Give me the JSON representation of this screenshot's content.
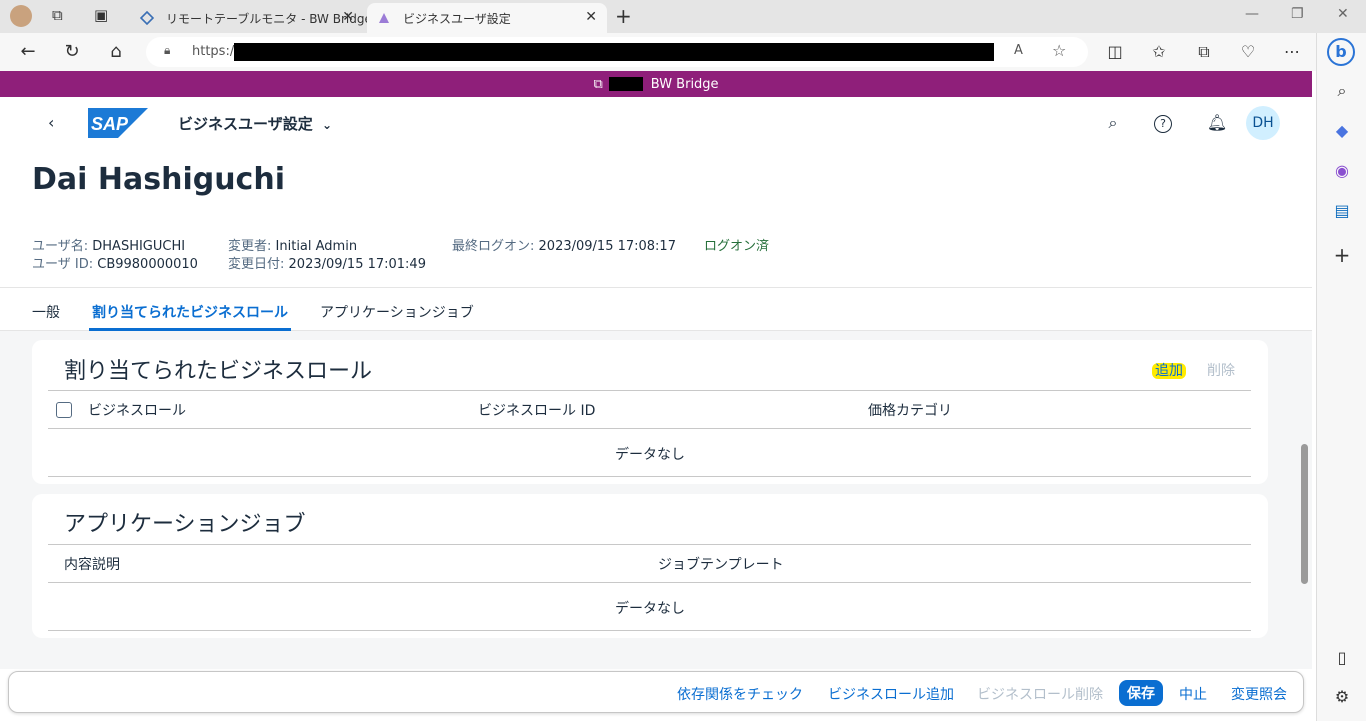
{
  "browser": {
    "tabs": [
      {
        "label": "リモートテーブルモニタ - BW Bridge (S",
        "active": false
      },
      {
        "label": "ビジネスユーザ設定",
        "active": true
      }
    ],
    "url_prefix": "https:/"
  },
  "banner": {
    "label": "BW Bridge"
  },
  "shell": {
    "app_title": "ビジネスユーザ設定",
    "avatar_initials": "DH"
  },
  "header": {
    "title": "Dai Hashiguchi",
    "user_name_label": "ユーザ名:",
    "user_name": "DHASHIGUCHI",
    "user_id_label": "ユーザ ID:",
    "user_id": "CB9980000010",
    "changed_by_label": "変更者:",
    "changed_by": "Initial Admin",
    "changed_on_label": "変更日付:",
    "changed_on": "2023/09/15 17:01:49",
    "last_logon_label": "最終ログオン:",
    "last_logon": "2023/09/15 17:08:17",
    "status": "ログオン済"
  },
  "tabs": [
    {
      "label": "一般"
    },
    {
      "label": "割り当てられたビジネスロール",
      "selected": true
    },
    {
      "label": "アプリケーションジョブ"
    }
  ],
  "roles_section": {
    "title": "割り当てられたビジネスロール",
    "add_label": "追加",
    "delete_label": "削除",
    "columns": [
      "ビジネスロール",
      "ビジネスロール ID",
      "価格カテゴリ"
    ],
    "empty_text": "データなし"
  },
  "jobs_section": {
    "title": "アプリケーションジョブ",
    "columns": [
      "内容説明",
      "ジョブテンプレート"
    ],
    "empty_text": "データなし"
  },
  "footer": {
    "check_dependencies": "依存関係をチェック",
    "add_role": "ビジネスロール追加",
    "delete_role": "ビジネスロール削除",
    "save": "保存",
    "cancel": "中止",
    "change_document": "変更照会"
  },
  "colors": {
    "banner": "#8f1f7a",
    "accent": "#0a6ed1",
    "status_green": "#256f3a",
    "highlight": "#ffeb00"
  }
}
